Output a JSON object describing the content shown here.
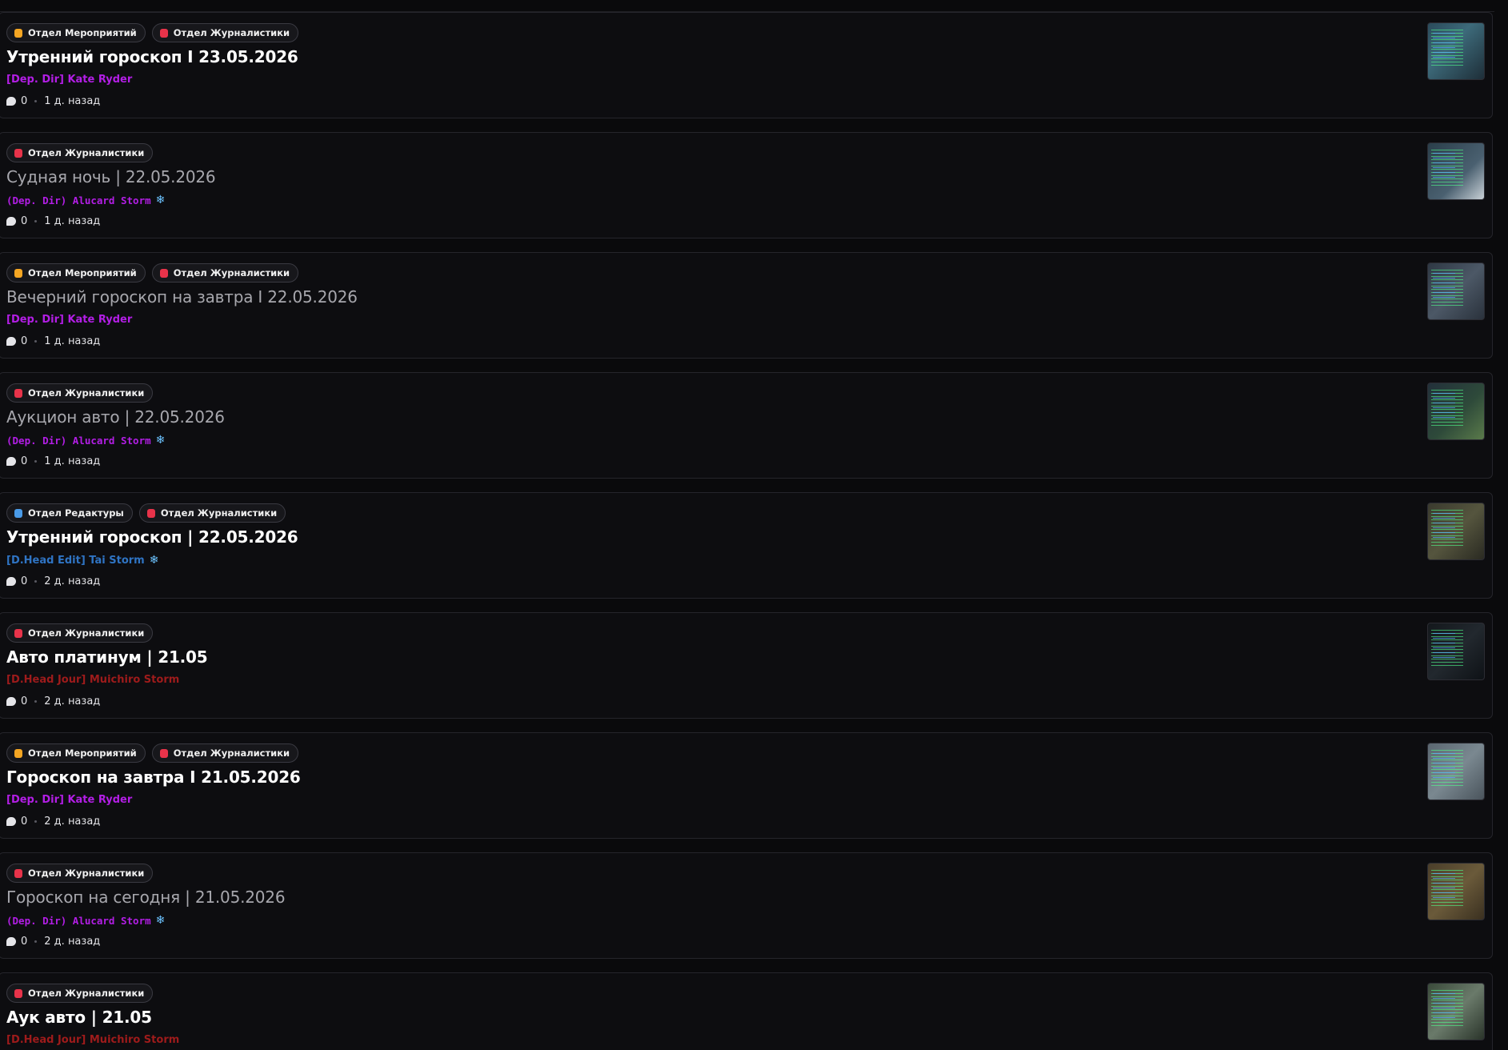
{
  "colors": {
    "events": "#f5a623",
    "journalism": "#e8334a",
    "editing": "#4a9be8",
    "dep_dir": "#b31ee6",
    "head_edit": "#2f74c4",
    "head_jour": "#9e1b1b"
  },
  "threads": [
    {
      "tags": [
        {
          "label": "Отдел Мероприятий",
          "color": "#f5a623"
        },
        {
          "label": "Отдел Журналистики",
          "color": "#e8334a"
        }
      ],
      "title": "Утренний гороскоп I 23.05.2026",
      "read": false,
      "author": "[Dep. Dir] Kate Ryder",
      "author_color": "#b31ee6",
      "author_style": "normal",
      "snowflake": "",
      "replies": "0",
      "time": "1 д. назад",
      "thumb_bg": "linear-gradient(135deg,#2a4a5a,#3d6a7a 40%,#1e2e38)"
    },
    {
      "tags": [
        {
          "label": "Отдел Журналистики",
          "color": "#e8334a"
        }
      ],
      "title": "Судная ночь | 22.05.2026",
      "read": true,
      "author": "(Dep. Dir) Alucard Storm",
      "author_color": "#b31ee6",
      "author_style": "mono",
      "snowflake": "❄",
      "replies": "0",
      "time": "1 д. назад",
      "thumb_bg": "linear-gradient(135deg,#2a3e4a,#4a6070 60%,#c8d0d6)"
    },
    {
      "tags": [
        {
          "label": "Отдел Мероприятий",
          "color": "#f5a623"
        },
        {
          "label": "Отдел Журналистики",
          "color": "#e8334a"
        }
      ],
      "title": "Вечерний гороскоп на завтра I 22.05.2026",
      "read": true,
      "author": "[Dep. Dir] Kate Ryder",
      "author_color": "#b31ee6",
      "author_style": "normal",
      "snowflake": "",
      "replies": "0",
      "time": "1 д. назад",
      "thumb_bg": "linear-gradient(135deg,#2e3844,#4c5866 50%,#2a323c)"
    },
    {
      "tags": [
        {
          "label": "Отдел Журналистики",
          "color": "#e8334a"
        }
      ],
      "title": "Аукцион авто | 22.05.2026",
      "read": true,
      "author": "(Dep. Dir) Alucard Storm",
      "author_color": "#b31ee6",
      "author_style": "mono",
      "snowflake": "❄",
      "replies": "0",
      "time": "1 д. назад",
      "thumb_bg": "linear-gradient(135deg,#22303a,#2e4a3a 55%,#5a7a4a)"
    },
    {
      "tags": [
        {
          "label": "Отдел Редактуры",
          "color": "#4a9be8"
        },
        {
          "label": "Отдел Журналистики",
          "color": "#e8334a"
        }
      ],
      "title": "Утренний гороскоп | 22.05.2026",
      "read": false,
      "author": "[D.Head Edit] Tai Storm",
      "author_color": "#2f74c4",
      "author_style": "normal",
      "snowflake": "❄",
      "replies": "0",
      "time": "2 д. назад",
      "thumb_bg": "linear-gradient(135deg,#3a3a2e,#55553e 50%,#2a2a22)"
    },
    {
      "tags": [
        {
          "label": "Отдел Журналистики",
          "color": "#e8334a"
        }
      ],
      "title": "Авто платинум | 21.05",
      "read": false,
      "author": "[D.Head Jour] Muichiro Storm",
      "author_color": "#9e1b1b",
      "author_style": "normal",
      "snowflake": "",
      "replies": "0",
      "time": "2 д. назад",
      "thumb_bg": "linear-gradient(135deg,#14181c,#22282e 50%,#0e1216)"
    },
    {
      "tags": [
        {
          "label": "Отдел Мероприятий",
          "color": "#f5a623"
        },
        {
          "label": "Отдел Журналистики",
          "color": "#e8334a"
        }
      ],
      "title": "Гороскоп на завтра I 21.05.2026",
      "read": false,
      "author": "[Dep. Dir] Kate Ryder",
      "author_color": "#b31ee6",
      "author_style": "normal",
      "snowflake": "",
      "replies": "0",
      "time": "2 д. назад",
      "thumb_bg": "linear-gradient(135deg,#5a6670,#7a8890 50%,#4a545c)"
    },
    {
      "tags": [
        {
          "label": "Отдел Журналистики",
          "color": "#e8334a"
        }
      ],
      "title": "Гороскоп на сегодня | 21.05.2026",
      "read": true,
      "author": "(Dep. Dir) Alucard Storm",
      "author_color": "#b31ee6",
      "author_style": "mono",
      "snowflake": "❄",
      "replies": "0",
      "time": "2 д. назад",
      "thumb_bg": "linear-gradient(135deg,#4a3e2a,#6a5a3a 50%,#3a3020)"
    },
    {
      "tags": [
        {
          "label": "Отдел Журналистики",
          "color": "#e8334a"
        }
      ],
      "title": "Аук авто | 21.05",
      "read": false,
      "author": "[D.Head Jour] Muichiro Storm",
      "author_color": "#9e1b1b",
      "author_style": "normal",
      "snowflake": "",
      "replies": "",
      "time": "",
      "thumb_bg": "linear-gradient(135deg,#3a4a3a,#6a7a6a 50%,#2a342a)"
    }
  ]
}
